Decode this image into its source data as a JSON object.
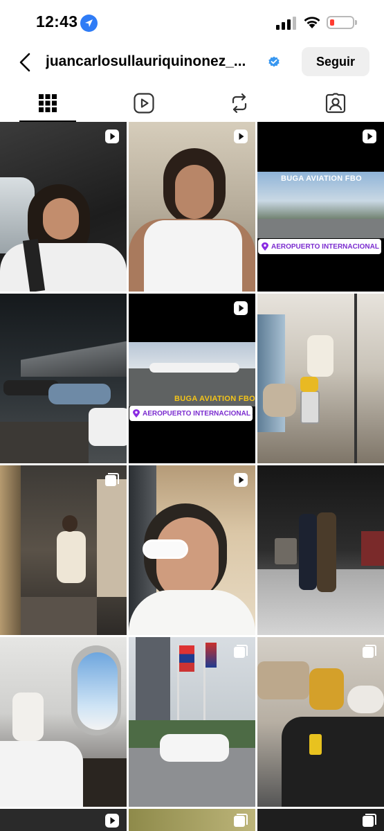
{
  "status_bar": {
    "time": "12:43",
    "icons": [
      "location-arrow-icon",
      "signal-icon",
      "wifi-icon",
      "battery-icon"
    ],
    "battery_color": "#ff3b30"
  },
  "header": {
    "username": "juancarlosullauriquinonez_...",
    "verified_icon": "verified-badge-icon",
    "verified_color": "#3897f0",
    "follow_label": "Seguir"
  },
  "tabs": [
    {
      "icon": "grid-icon",
      "active": true
    },
    {
      "icon": "reels-icon",
      "active": false
    },
    {
      "icon": "reposts-icon",
      "active": false
    },
    {
      "icon": "tagged-icon",
      "active": false
    }
  ],
  "posts": [
    {
      "type": "reel",
      "desc": "man in car coughing"
    },
    {
      "type": "reel",
      "desc": "man in white tank top"
    },
    {
      "type": "reel",
      "fbo_text": "BUGA AVIATION FBO",
      "location": "AEROPUERTO INTERNACIONAL JOSÉ JOA..."
    },
    {
      "type": "photo",
      "desc": "parking lot at night"
    },
    {
      "type": "reel",
      "fbo_text": "BUGA AVIATION FBO",
      "location": "AEROPUERTO INTERNACIONAL JOSÉ JOA..."
    },
    {
      "type": "photo",
      "desc": "airport lounge"
    },
    {
      "type": "carousel",
      "desc": "man sitting in boutique"
    },
    {
      "type": "reel",
      "desc": "man with white sunglasses"
    },
    {
      "type": "photo",
      "desc": "two people in lobby"
    },
    {
      "type": "photo",
      "desc": "private jet cabin"
    },
    {
      "type": "carousel",
      "desc": "flags and white car"
    },
    {
      "type": "carousel",
      "desc": "lounge with bags"
    },
    {
      "type": "reel",
      "desc": "partial tile"
    },
    {
      "type": "carousel",
      "desc": "partial tile"
    },
    {
      "type": "carousel",
      "desc": "partial tile"
    }
  ]
}
